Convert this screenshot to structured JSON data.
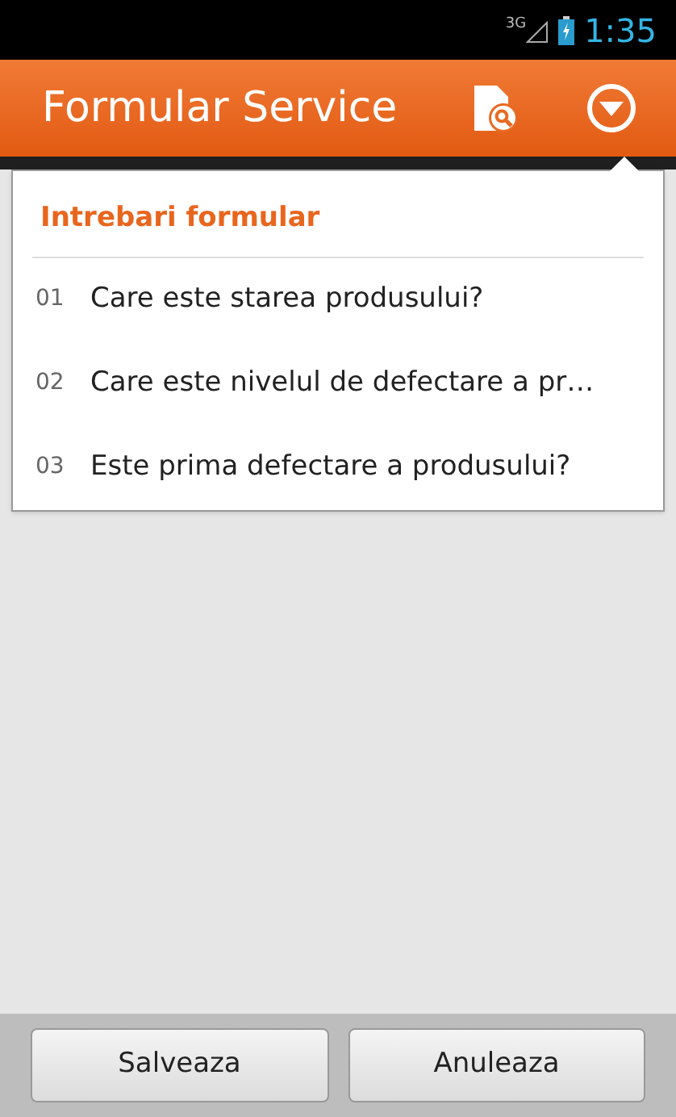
{
  "status_bar": {
    "network": "3G",
    "time": "1:35"
  },
  "action_bar": {
    "title": "Formular Service"
  },
  "menu": {
    "title": "Intrebari formular",
    "items": [
      {
        "number": "01",
        "label": "Care este starea produsului?"
      },
      {
        "number": "02",
        "label": "Care este nivelul de defectare a pr…"
      },
      {
        "number": "03",
        "label": "Este prima defectare a produsului?"
      }
    ]
  },
  "buttons": [
    "Salveaza",
    "Anuleaza"
  ]
}
